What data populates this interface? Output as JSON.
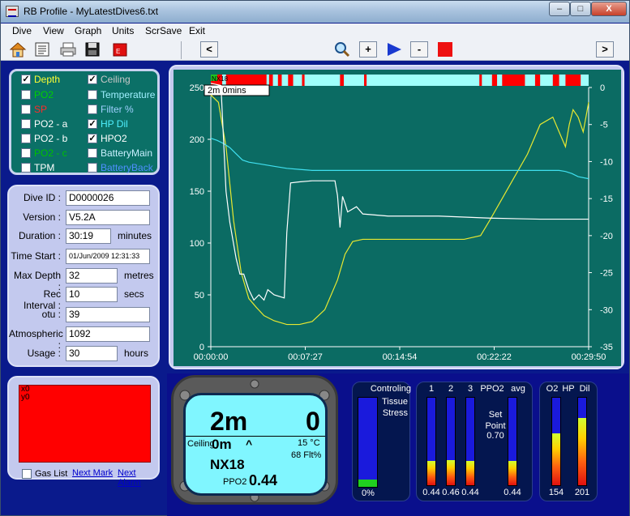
{
  "window": {
    "title": "RB Profile - MyLatestDives6.txt",
    "controls": {
      "minimize": "–",
      "maximize": "□",
      "close": "X"
    }
  },
  "menu": [
    "Dive",
    "View",
    "Graph",
    "Units",
    "ScrSave",
    "Exit"
  ],
  "toolbar": {
    "prev": "<",
    "next": ">",
    "plus": "+",
    "minus": "-",
    "icons": [
      "home-icon",
      "notes-icon",
      "printer-icon",
      "save-icon",
      "export-icon",
      "zoom-icon",
      "play-icon",
      "stop-icon"
    ]
  },
  "graph_options": [
    {
      "label": "Depth",
      "checked": true,
      "color": "#ffff33"
    },
    {
      "label": "PO2",
      "checked": false,
      "color": "#00d000"
    },
    {
      "label": "SP",
      "checked": false,
      "color": "#ff2a2a"
    },
    {
      "label": "PO2 - a",
      "checked": false,
      "color": "#ffffff"
    },
    {
      "label": "PO2 - b",
      "checked": false,
      "color": "#ffffff"
    },
    {
      "label": "PO2 - c",
      "checked": false,
      "color": "#00c000"
    },
    {
      "label": "TPM",
      "checked": false,
      "color": "#ffffff"
    },
    {
      "label": "Ceiling",
      "checked": true,
      "color": "#c8c8c8"
    },
    {
      "label": "Temperature",
      "checked": false,
      "color": "#9ff0ff"
    },
    {
      "label": "Filter %",
      "checked": false,
      "color": "#9fd0ff"
    },
    {
      "label": "HP Dil",
      "checked": true,
      "color": "#4ff0ff"
    },
    {
      "label": "HPO2",
      "checked": true,
      "color": "#ffffff"
    },
    {
      "label": "BatteryMain",
      "checked": false,
      "color": "#c8f0ff"
    },
    {
      "label": "BatteryBack",
      "checked": false,
      "color": "#4f8fff"
    }
  ],
  "dive_info": [
    {
      "label": "Dive ID :",
      "value": "D0000026",
      "unit": ""
    },
    {
      "label": "Version :",
      "value": "V5.2A",
      "unit": ""
    },
    {
      "label": "Duration :",
      "value": "30:19",
      "unit": "minutes"
    },
    {
      "label": "Time Start :",
      "value": "01/Jun/2009 12:31:33",
      "unit": ""
    },
    {
      "label": "Max Depth :",
      "value": "32",
      "unit": "metres"
    },
    {
      "label": "Rec Interval :",
      "value": "10",
      "unit": "secs"
    },
    {
      "label": "otu :",
      "value": "39",
      "unit": ""
    },
    {
      "label": "Atmospheric :",
      "value": "1092",
      "unit": ""
    },
    {
      "label": "Usage :",
      "value": "30",
      "unit": "hours"
    }
  ],
  "gas_panel": {
    "lines": [
      "x0",
      "y0"
    ],
    "gas_list_label": "Gas List",
    "next_mark": "Next Mark",
    "next_alarm": "Next Alarm"
  },
  "chart_data": {
    "type": "line",
    "y_left_ticks": [
      "250",
      "200",
      "150",
      "100",
      "50",
      "0"
    ],
    "y_left_range": [
      0,
      250
    ],
    "y_right_ticks": [
      "0",
      "-5",
      "-10",
      "-15",
      "-20",
      "-25",
      "-30",
      "-35"
    ],
    "y_right_range": [
      -35,
      0
    ],
    "x_ticks": [
      "00:00:00",
      "00:07:27",
      "00:14:54",
      "00:22:22",
      "00:29:50"
    ],
    "x_range_min": [
      0,
      29.83
    ],
    "gas_tag": "NX18",
    "cursor_label": "2m   0mins",
    "colors": {
      "bg": "#0b6b63",
      "depth": "#e8e830",
      "hpdil": "#40e0f0",
      "hpo2": "#ffffff",
      "ceiling": "#ffffff"
    },
    "series": [
      {
        "name": "Depth",
        "axis": "right",
        "x": [
          0,
          0.6,
          1.2,
          1.8,
          2.4,
          3.0,
          3.6,
          4.2,
          5.0,
          6.0,
          7.0,
          8.0,
          9.0,
          10.0,
          10.6,
          11.2,
          12.0,
          14.0,
          16.0,
          18.0,
          20.0,
          21.3,
          22.0,
          23.0,
          24.0,
          25.0,
          26.0,
          27.0,
          27.5,
          28.0,
          28.3,
          28.6,
          29.0,
          29.4,
          29.83
        ],
        "y": [
          -1,
          -2,
          -8,
          -18,
          -25,
          -28.5,
          -29.7,
          -30.8,
          -31.5,
          -32,
          -32,
          -31.6,
          -30,
          -26,
          -22.5,
          -20.8,
          -20.5,
          -20.5,
          -20.5,
          -20.5,
          -20.5,
          -20,
          -18,
          -15,
          -12,
          -9,
          -5,
          -4,
          -6,
          -8,
          -5,
          -3,
          -4,
          -6,
          -2
        ]
      },
      {
        "name": "HP Dil",
        "axis": "left",
        "x": [
          0,
          0.5,
          1.0,
          1.5,
          2.0,
          2.5,
          3.0,
          4.0,
          5.0,
          6.0,
          7.0,
          8.0,
          10.0,
          14.0,
          18.0,
          22.0,
          26.0,
          27.5,
          28.0,
          28.5,
          29.0,
          29.83
        ],
        "y": [
          201,
          199,
          196,
          192,
          186,
          180,
          178,
          176,
          174,
          172,
          171,
          170,
          170,
          170,
          170,
          170,
          170,
          170,
          169,
          167,
          164,
          162
        ]
      },
      {
        "name": "HPO2",
        "axis": "left",
        "x": [
          0,
          0.8,
          1.2,
          1.5,
          2.0,
          2.3,
          2.6,
          3.0,
          3.4,
          3.8,
          4.2,
          4.5,
          5.0,
          5.8,
          6.0,
          6.3,
          7.0,
          8.0,
          9.0,
          9.8,
          10.0,
          10.2,
          10.4,
          10.6,
          10.8,
          11.5,
          12.0,
          14.0,
          18.0,
          22.0,
          26.0,
          29.0,
          29.83
        ],
        "y": [
          254,
          252,
          150,
          120,
          85,
          70,
          70,
          55,
          45,
          50,
          45,
          55,
          50,
          47,
          110,
          158,
          159,
          160,
          160,
          160,
          146,
          115,
          145,
          138,
          130,
          135,
          128,
          126,
          126,
          124,
          123,
          123,
          123
        ]
      }
    ],
    "top_strip": {
      "colors": [
        "#ff0000",
        "#9ffffb"
      ],
      "note": "alarm timeline strip"
    }
  },
  "computer": {
    "depth": "2m",
    "time": "0",
    "ceiling_label": "Ceiling",
    "ceiling_value": "0m",
    "arrow": "^",
    "temp": "15 °C",
    "feet": "68 Flt%",
    "gas": "NX18",
    "ppo2_label": "PPO2",
    "ppo2_value": "0.44"
  },
  "tissue_panel": {
    "label1": "Controling",
    "label2": "Tissue",
    "label3": "Stress",
    "value": "0%",
    "fill_fraction": 0.08
  },
  "ppo2_panel": {
    "headers": [
      "1",
      "2",
      "3",
      "PPO2",
      "avg"
    ],
    "setpoint_label1": "Set",
    "setpoint_label2": "Point",
    "setpoint_value": "0.70",
    "values": [
      "0.44",
      "0.46",
      "0.44",
      "0.44"
    ]
  },
  "hp_panel": {
    "headers": [
      "O2",
      "HP",
      "Dil"
    ],
    "values": [
      "154",
      "201"
    ]
  }
}
